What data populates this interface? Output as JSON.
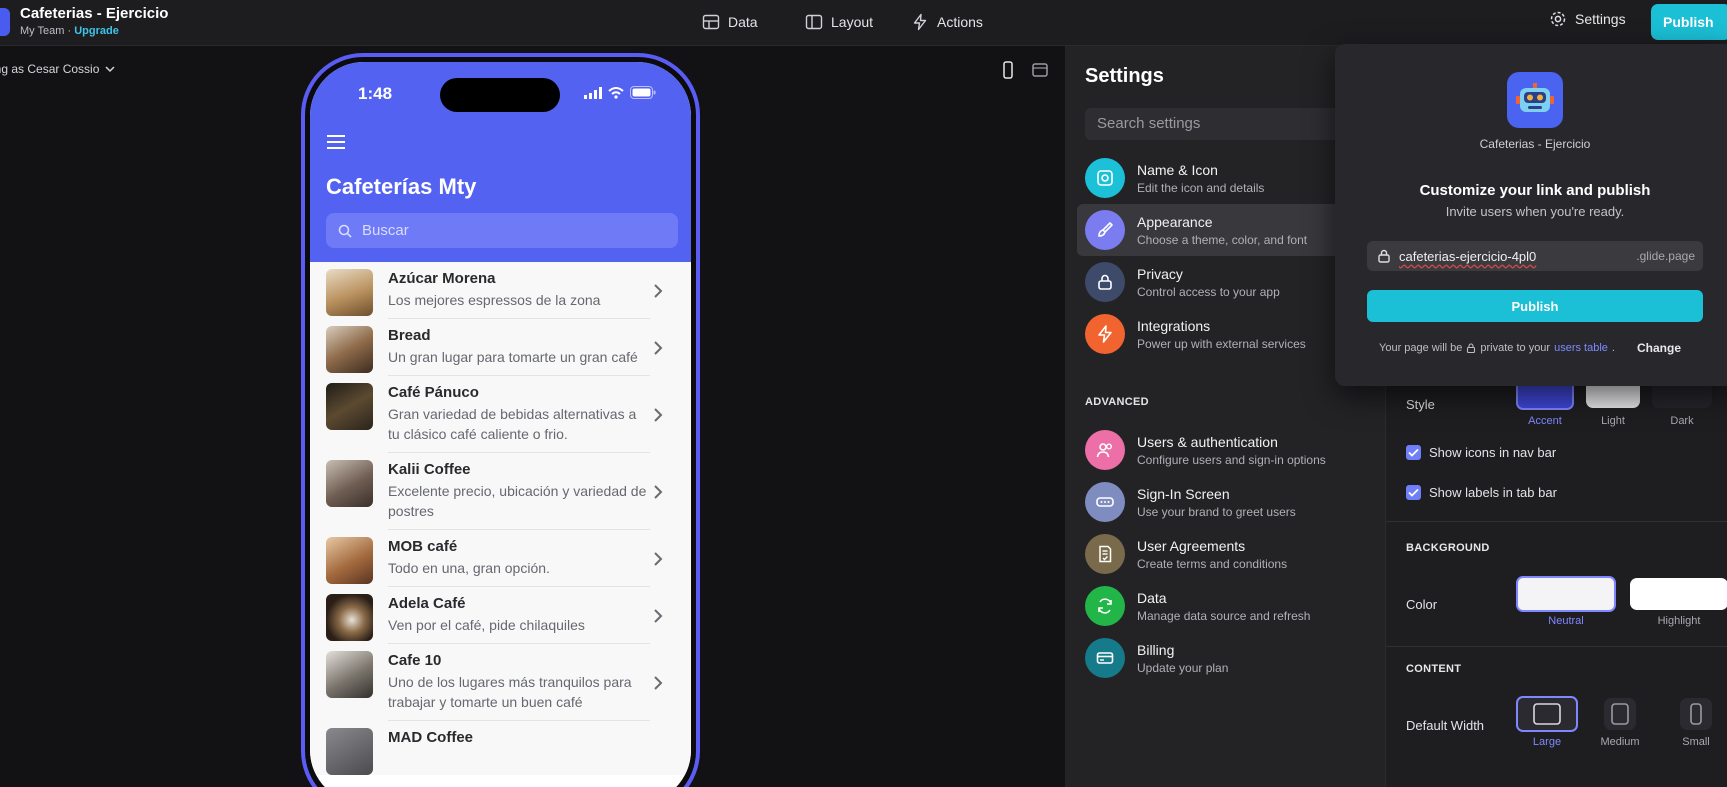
{
  "header": {
    "app_title": "Cafeterias - Ejercicio",
    "team": "My Team · ",
    "upgrade": "Upgrade",
    "nav": [
      {
        "label": "Data",
        "icon": "table-icon"
      },
      {
        "label": "Layout",
        "icon": "layout-icon"
      },
      {
        "label": "Actions",
        "icon": "bolt-icon"
      }
    ],
    "settings_label": "Settings",
    "publish_label": "Publish"
  },
  "viewing_as": "ing as Cesar Cossio",
  "phone": {
    "time": "1:48",
    "title": "Cafeterías Mty",
    "search_placeholder": "Buscar",
    "items": [
      {
        "name": "Azúcar Morena",
        "desc": "Los mejores espressos de la zona",
        "thumb": "#b9915e"
      },
      {
        "name": "Bread",
        "desc": "Un gran lugar para tomarte un gran café",
        "thumb": "#8f6b4a"
      },
      {
        "name": "Café Pánuco",
        "desc": "Gran variedad de bebidas alternativas a tu clásico café caliente o frio.",
        "thumb": "#3b3225"
      },
      {
        "name": "Kalii Coffee",
        "desc": "Excelente precio, ubicación y variedad de postres",
        "thumb": "#6f5d52"
      },
      {
        "name": "MOB café",
        "desc": "Todo en una, gran opción.",
        "thumb": "#a46a3e"
      },
      {
        "name": "Adela Café",
        "desc": "Ven por el café, pide chilaquiles",
        "thumb": "#3a2c22"
      },
      {
        "name": "Cafe 10",
        "desc": "Uno de los lugares más tranquilos para trabajar y tomarte un buen café",
        "thumb": "#7a746c"
      },
      {
        "name": "MAD Coffee",
        "desc": "",
        "thumb": "#4b4b4f"
      }
    ]
  },
  "settings": {
    "title": "Settings",
    "search_placeholder": "Search settings",
    "advanced_label": "ADVANCED",
    "items": [
      {
        "title": "Name & Icon",
        "sub": "Edit the icon and details",
        "color": "#1cc1d8"
      },
      {
        "title": "Appearance",
        "sub": "Choose a theme, color, and font",
        "color": "#7a7cf0"
      },
      {
        "title": "Privacy",
        "sub": "Control access to your app",
        "color": "#3e4a6a"
      },
      {
        "title": "Integrations",
        "sub": "Power up with external services",
        "color": "#f2642f"
      },
      {
        "title": "Users & authentication",
        "sub": "Configure users and sign-in options",
        "color": "#ec6fa8"
      },
      {
        "title": "Sign-In Screen",
        "sub": "Use your brand to greet users",
        "color": "#7f8cc0"
      },
      {
        "title": "User Agreements",
        "sub": "Create terms and conditions",
        "color": "#7a6a4c"
      },
      {
        "title": "Data",
        "sub": "Manage data source and refresh",
        "color": "#22b648"
      },
      {
        "title": "Billing",
        "sub": "Update your plan",
        "color": "#157a8a"
      }
    ]
  },
  "appearance": {
    "style_label": "Style",
    "style_options": [
      "Accent",
      "Light",
      "Dark"
    ],
    "show_icons_nav": "Show icons in nav bar",
    "show_labels_tab": "Show labels in tab bar",
    "background_label": "BACKGROUND",
    "color_label": "Color",
    "color_options": [
      "Neutral",
      "Highlight"
    ],
    "content_label": "CONTENT",
    "default_width_label": "Default Width",
    "width_options": [
      "Large",
      "Medium",
      "Small"
    ]
  },
  "popup": {
    "app_name": "Cafeterias - Ejercicio",
    "title": "Customize your link and publish",
    "subtitle": "Invite users when you're ready.",
    "link_value": "cafeterias-ejercicio-4pl0",
    "link_domain": ".glide.page",
    "publish_label": "Publish",
    "footer_pre": "Your page will be ",
    "footer_mid": " private to your ",
    "footer_link": "users table",
    "footer_end": ".",
    "change_label": "Change"
  },
  "colors": {
    "accent": "#5462f2",
    "publish": "#1bbfd6",
    "phone_frame": "#5b5cf6"
  }
}
